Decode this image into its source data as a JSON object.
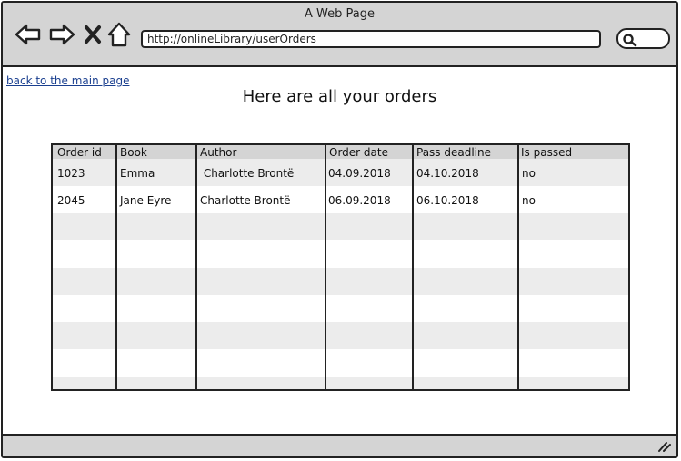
{
  "window": {
    "title": "A Web Page"
  },
  "browser": {
    "url": "http://onlineLibrary/userOrders",
    "icons": [
      "back-arrow-icon",
      "forward-arrow-icon",
      "close-x-icon",
      "home-icon",
      "search-icon"
    ]
  },
  "page": {
    "back_link": "back to the main page",
    "heading": "Here are all your orders"
  },
  "table": {
    "columns": [
      "Order id",
      "Book",
      "Author",
      "Order date",
      "Pass deadline",
      "Is passed"
    ],
    "rows": [
      [
        "1023",
        "Emma",
        " Charlotte Brontë",
        "04.09.2018",
        "04.10.2018",
        "no"
      ],
      [
        "2045",
        "Jane Eyre",
        "Charlotte Brontë",
        "06.09.2018",
        "06.10.2018",
        "no"
      ]
    ]
  },
  "colors": {
    "chrome": "#d4d4d4",
    "stripe": "#ececec",
    "link": "#1a3f8f",
    "border": "#222222"
  }
}
